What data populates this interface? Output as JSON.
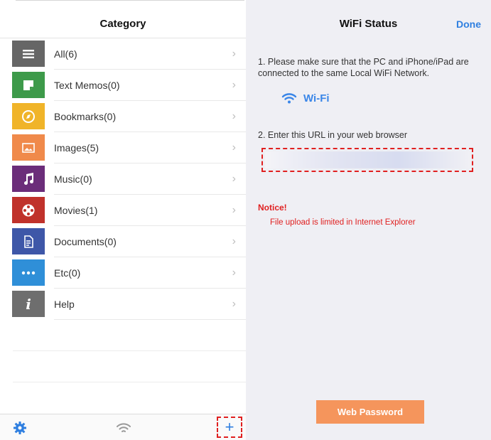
{
  "left": {
    "title": "Category",
    "categories": [
      {
        "label": "All(6)",
        "icon": "list-icon",
        "color": "#666666"
      },
      {
        "label": "Text Memos(0)",
        "icon": "memo-icon",
        "color": "#3d9a4a"
      },
      {
        "label": "Bookmarks(0)",
        "icon": "compass-icon",
        "color": "#f0b429"
      },
      {
        "label": "Images(5)",
        "icon": "image-icon",
        "color": "#f08a4b"
      },
      {
        "label": "Music(0)",
        "icon": "music-note-icon",
        "color": "#6b2d7a"
      },
      {
        "label": "Movies(1)",
        "icon": "film-reel-icon",
        "color": "#c0322b"
      },
      {
        "label": "Documents(0)",
        "icon": "document-icon",
        "color": "#3e57a8"
      },
      {
        "label": "Etc(0)",
        "icon": "more-dots-icon",
        "color": "#2f8fd8"
      },
      {
        "label": "Help",
        "icon": "info-icon",
        "color": "#6e6e6e"
      }
    ],
    "chevron": "›",
    "tabbar": {
      "gear_icon": "gear-icon",
      "wifi_icon": "wifi-icon",
      "plus_label": "+"
    }
  },
  "right": {
    "title": "WiFi Status",
    "done_label": "Done",
    "step1": "1. Please make sure that the PC and iPhone/iPad are connected to the same Local WiFi Network.",
    "wifi_name": "Wi-Fi",
    "step2": "2. Enter this URL in your web browser",
    "notice_title": "Notice!",
    "notice_text": "File upload is limited in Internet Explorer",
    "web_password_label": "Web Password"
  },
  "colors": {
    "accent_blue": "#2f7fe0",
    "notice_red": "#e02020",
    "button_orange": "#f5955c"
  }
}
